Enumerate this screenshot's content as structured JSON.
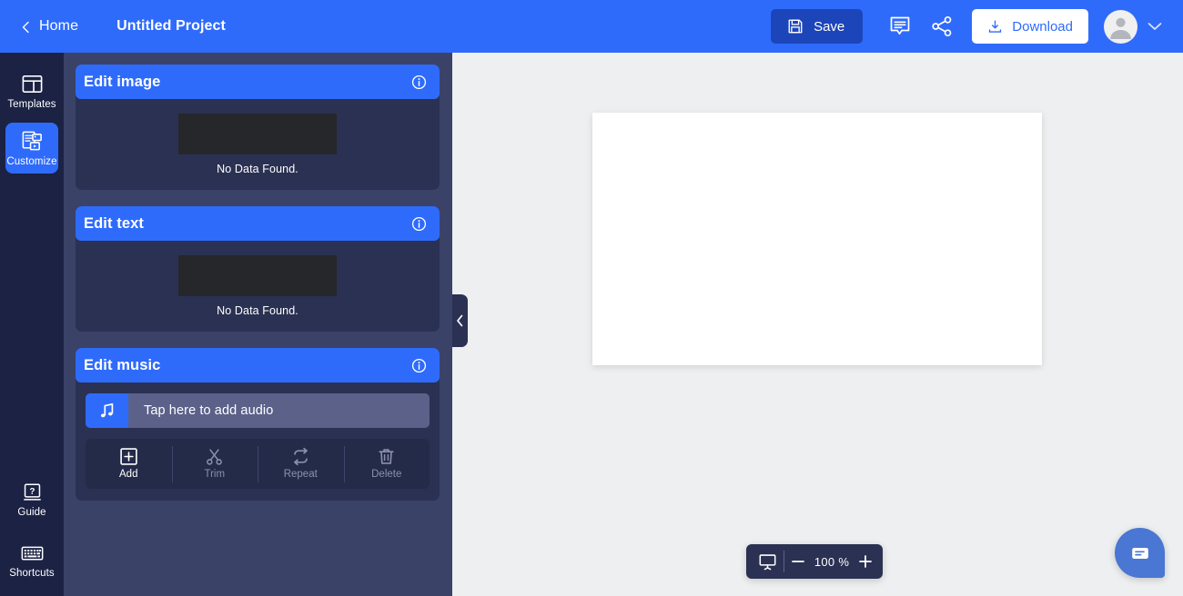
{
  "topbar": {
    "back_icon": "chevron-left-icon",
    "home_label": "Home",
    "project_title": "Untitled Project",
    "save_label": "Save",
    "save_icon": "floppy-disk-icon",
    "comment_icon": "comment-bubble-icon",
    "share_icon": "share-nodes-icon",
    "download_label": "Download",
    "download_icon": "download-icon",
    "avatar_icon": "user-avatar-icon",
    "caret_icon": "chevron-down-icon",
    "accent_color": "#2f6bfb",
    "save_button_color": "#1c45ba"
  },
  "rail": {
    "items": [
      {
        "label": "Templates",
        "icon": "layout-template-icon",
        "active": false
      },
      {
        "label": "Customize",
        "icon": "customize-media-icon",
        "active": true
      }
    ],
    "bottom_items": [
      {
        "label": "Guide",
        "icon": "book-question-icon"
      },
      {
        "label": "Shortcuts",
        "icon": "keyboard-icon"
      }
    ],
    "background_color": "#1b2244",
    "active_color": "#2f6bfb"
  },
  "panel": {
    "background_color": "#3b4268",
    "collapse_icon": "chevron-left-icon",
    "cards": [
      {
        "title": "Edit image",
        "info_icon": "info-circle-icon",
        "empty_text": "No Data Found.",
        "placeholder_icon": "broken-image-icon"
      },
      {
        "title": "Edit text",
        "info_icon": "info-circle-icon",
        "empty_text": "No Data Found.",
        "placeholder_icon": "broken-image-icon"
      }
    ],
    "music_card": {
      "title": "Edit music",
      "info_icon": "info-circle-icon",
      "audio_icon": "music-note-icon",
      "audio_placeholder": "Tap here to add audio",
      "tools": [
        {
          "label": "Add",
          "icon": "plus-square-icon",
          "active": true
        },
        {
          "label": "Trim",
          "icon": "scissors-icon",
          "active": false
        },
        {
          "label": "Repeat",
          "icon": "repeat-loop-icon",
          "active": false
        },
        {
          "label": "Delete",
          "icon": "trash-icon",
          "active": false
        }
      ]
    }
  },
  "canvas": {
    "background_color": "#eeeff0",
    "slide_color": "#ffffff"
  },
  "zoom_control": {
    "screen_icon": "presentation-screen-icon",
    "minus_label": "−",
    "value": "100 %",
    "plus_label": "+"
  },
  "chat": {
    "icon": "chat-message-icon",
    "color": "#4a76d4"
  }
}
